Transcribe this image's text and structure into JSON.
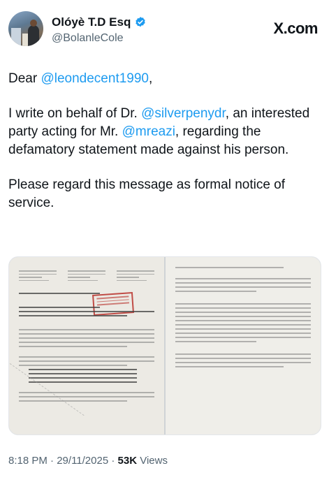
{
  "author": {
    "display_name": "Olóyè T.D Esq",
    "handle": "@BolanleCole",
    "verified": true
  },
  "brand": {
    "logo_text": "X.com"
  },
  "tweet": {
    "greeting_prefix": "Dear ",
    "greeting_mention": "@leondecent1990",
    "greeting_suffix": ",",
    "para2_a": "I write on behalf of Dr. ",
    "para2_mention1": "@silverpenydr",
    "para2_b": ", an interested party acting for Mr. ",
    "para2_mention2": "@mreazi",
    "para2_c": ", regarding the defamatory statement made against his person.",
    "para3": "Please regard this message as formal notice of service."
  },
  "media": {
    "pages": 2
  },
  "meta": {
    "time": "8:18 PM",
    "separator1": " · ",
    "date": "29/11/2025",
    "separator2": " · ",
    "views_count": "53K",
    "views_label": " Views"
  },
  "colors": {
    "mention": "#1d9bf0",
    "verified": "#1d9bf0",
    "secondary_text": "#536471"
  }
}
